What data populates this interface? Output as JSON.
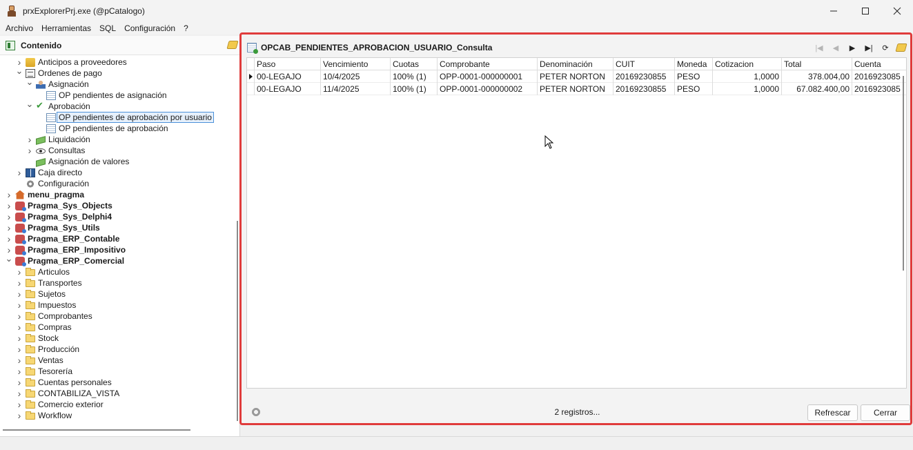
{
  "window": {
    "title": "prxExplorerPrj.exe (@pCatalogo)",
    "controls": [
      "minimize-icon",
      "maximize-icon",
      "close-icon"
    ]
  },
  "menu": [
    "Archivo",
    "Herramientas",
    "SQL",
    "Configuración",
    "?"
  ],
  "left_panel": {
    "title": "Contenido",
    "tree": [
      {
        "label": "Anticipos a proveedores",
        "icon": "coins-icon",
        "depth": 1,
        "expander": "collapsed",
        "bold": false,
        "selected": false
      },
      {
        "label": "Ordenes de pago",
        "icon": "document-icon",
        "depth": 1,
        "expander": "expanded",
        "bold": false,
        "selected": false
      },
      {
        "label": "Asignación",
        "icon": "person-icon",
        "depth": 2,
        "expander": "expanded",
        "bold": false,
        "selected": false
      },
      {
        "label": "OP pendientes de asignación",
        "icon": "grid-icon",
        "depth": 3,
        "expander": "none",
        "bold": false,
        "selected": false
      },
      {
        "label": "Aprobación",
        "icon": "check-icon",
        "depth": 2,
        "expander": "expanded",
        "bold": false,
        "selected": false
      },
      {
        "label": "OP pendientes de aprobación por usuario",
        "icon": "grid-icon",
        "depth": 3,
        "expander": "none",
        "bold": false,
        "selected": true
      },
      {
        "label": "OP pendientes de aprobación",
        "icon": "grid-icon",
        "depth": 3,
        "expander": "none",
        "bold": false,
        "selected": false
      },
      {
        "label": "Liquidación",
        "icon": "money-icon",
        "depth": 2,
        "expander": "collapsed",
        "bold": false,
        "selected": false
      },
      {
        "label": "Consultas",
        "icon": "eye-icon",
        "depth": 2,
        "expander": "collapsed",
        "bold": false,
        "selected": false
      },
      {
        "label": "Asignación de valores",
        "icon": "money-icon",
        "depth": 2,
        "expander": "none",
        "bold": false,
        "selected": false
      },
      {
        "label": "Caja directo",
        "icon": "book-icon",
        "depth": 1,
        "expander": "collapsed",
        "bold": false,
        "selected": false
      },
      {
        "label": "Configuración",
        "icon": "gear-icon",
        "depth": 1,
        "expander": "none",
        "bold": false,
        "selected": false
      },
      {
        "label": "menu_pragma",
        "icon": "house-icon",
        "depth": 0,
        "expander": "collapsed",
        "bold": true,
        "selected": false
      },
      {
        "label": "Pragma_Sys_Objects",
        "icon": "database-icon",
        "depth": 0,
        "expander": "collapsed",
        "bold": true,
        "selected": false
      },
      {
        "label": "Pragma_Sys_Delphi4",
        "icon": "database-icon",
        "depth": 0,
        "expander": "collapsed",
        "bold": true,
        "selected": false
      },
      {
        "label": "Pragma_Sys_Utils",
        "icon": "database-icon",
        "depth": 0,
        "expander": "collapsed",
        "bold": true,
        "selected": false
      },
      {
        "label": "Pragma_ERP_Contable",
        "icon": "database-icon",
        "depth": 0,
        "expander": "collapsed",
        "bold": true,
        "selected": false
      },
      {
        "label": "Pragma_ERP_Impositivo",
        "icon": "database-icon",
        "depth": 0,
        "expander": "collapsed",
        "bold": true,
        "selected": false
      },
      {
        "label": "Pragma_ERP_Comercial",
        "icon": "database-icon",
        "depth": 0,
        "expander": "expanded",
        "bold": true,
        "selected": false
      },
      {
        "label": "Articulos",
        "icon": "folder-icon",
        "depth": 1,
        "expander": "collapsed",
        "bold": false,
        "selected": false
      },
      {
        "label": "Transportes",
        "icon": "folder-icon",
        "depth": 1,
        "expander": "collapsed",
        "bold": false,
        "selected": false
      },
      {
        "label": "Sujetos",
        "icon": "folder-icon",
        "depth": 1,
        "expander": "collapsed",
        "bold": false,
        "selected": false
      },
      {
        "label": "Impuestos",
        "icon": "folder-icon",
        "depth": 1,
        "expander": "collapsed",
        "bold": false,
        "selected": false
      },
      {
        "label": "Comprobantes",
        "icon": "folder-icon",
        "depth": 1,
        "expander": "collapsed",
        "bold": false,
        "selected": false
      },
      {
        "label": "Compras",
        "icon": "folder-icon",
        "depth": 1,
        "expander": "collapsed",
        "bold": false,
        "selected": false
      },
      {
        "label": "Stock",
        "icon": "folder-icon",
        "depth": 1,
        "expander": "collapsed",
        "bold": false,
        "selected": false
      },
      {
        "label": "Producción",
        "icon": "folder-icon",
        "depth": 1,
        "expander": "collapsed",
        "bold": false,
        "selected": false
      },
      {
        "label": "Ventas",
        "icon": "folder-icon",
        "depth": 1,
        "expander": "collapsed",
        "bold": false,
        "selected": false
      },
      {
        "label": "Tesorería",
        "icon": "folder-icon",
        "depth": 1,
        "expander": "collapsed",
        "bold": false,
        "selected": false
      },
      {
        "label": "Cuentas personales",
        "icon": "folder-icon",
        "depth": 1,
        "expander": "collapsed",
        "bold": false,
        "selected": false
      },
      {
        "label": "CONTABILIZA_VISTA",
        "icon": "folder-icon",
        "depth": 1,
        "expander": "collapsed",
        "bold": false,
        "selected": false
      },
      {
        "label": "Comercio exterior",
        "icon": "folder-icon",
        "depth": 1,
        "expander": "collapsed",
        "bold": false,
        "selected": false
      },
      {
        "label": "Workflow",
        "icon": "folder-icon",
        "depth": 1,
        "expander": "collapsed",
        "bold": false,
        "selected": false
      }
    ]
  },
  "right_panel": {
    "title": "OPCAB_PENDIENTES_APROBACION_USUARIO_Consulta",
    "nav_icons": [
      "first-record-icon",
      "prior-record-icon",
      "next-record-icon",
      "last-record-icon",
      "refresh-icon",
      "pin-icon"
    ],
    "grid": {
      "columns": [
        "Paso",
        "Vencimiento",
        "Cuotas",
        "Comprobante",
        "Denominación",
        "CUIT",
        "Moneda",
        "Cotizacion",
        "Total",
        "Cuenta"
      ],
      "rows": [
        [
          "00-LEGAJO",
          "10/4/2025",
          "100% (1)",
          "OPP-0001-000000001",
          "PETER NORTON",
          "20169230855",
          "PESO",
          "1,0000",
          "378.004,00",
          "2016923085"
        ],
        [
          "00-LEGAJO",
          "11/4/2025",
          "100% (1)",
          "OPP-0001-000000002",
          "PETER NORTON",
          "20169230855",
          "PESO",
          "1,0000",
          "67.082.400,00",
          "2016923085"
        ]
      ],
      "current_row": 0
    },
    "footer": {
      "status": "2 registros...",
      "refresh_label": "Refrescar",
      "close_label": "Cerrar"
    }
  },
  "colors": {
    "highlight_border": "#e03b3b",
    "selection_border": "#4a90d9"
  }
}
